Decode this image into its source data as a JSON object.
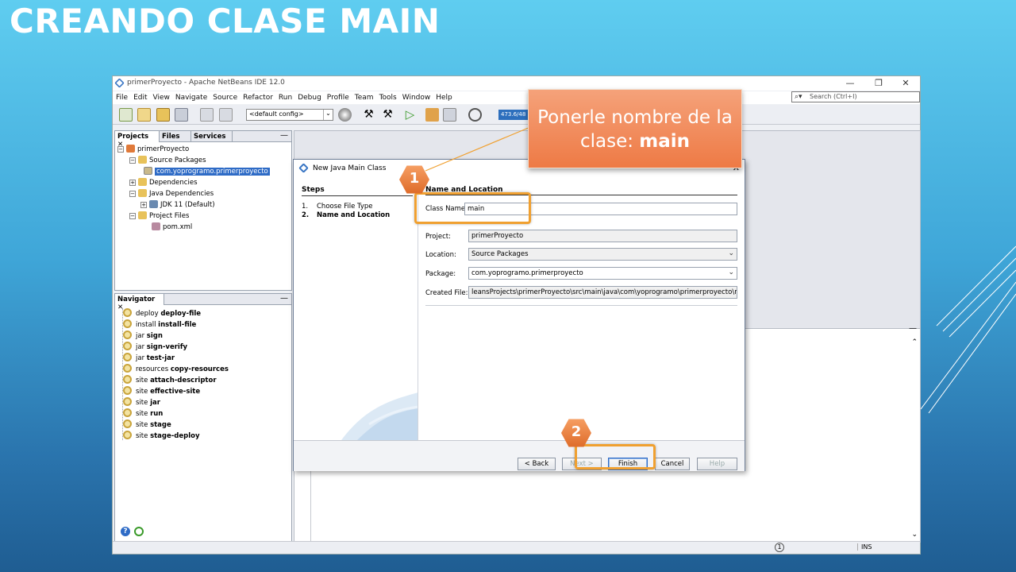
{
  "slide_title": "CREANDO CLASE MAIN",
  "window": {
    "title": "primerProyecto - Apache NetBeans IDE 12.0",
    "minimize": "—",
    "restore": "❐",
    "close": "✕"
  },
  "menu": [
    "File",
    "Edit",
    "View",
    "Navigate",
    "Source",
    "Refactor",
    "Run",
    "Debug",
    "Profile",
    "Team",
    "Tools",
    "Window",
    "Help"
  ],
  "search": {
    "placeholder": "Search (Ctrl+I)"
  },
  "toolbar": {
    "config": "<default config>",
    "memory": "473.6/48"
  },
  "projects_panel": {
    "tabs": [
      "Projects",
      "Files",
      "Services"
    ],
    "tree": [
      {
        "label": "primerProyecto"
      },
      {
        "label": "Source Packages"
      },
      {
        "label": "com.yoprogramo.primerproyecto"
      },
      {
        "label": "Dependencies"
      },
      {
        "label": "Java Dependencies"
      },
      {
        "label": "JDK 11 (Default)"
      },
      {
        "label": "Project Files"
      },
      {
        "label": "pom.xml"
      }
    ]
  },
  "navigator": {
    "tab": "Navigator",
    "items": [
      {
        "prefix": "deploy",
        "name": "deploy-file"
      },
      {
        "prefix": "install",
        "name": "install-file"
      },
      {
        "prefix": "jar",
        "name": "sign"
      },
      {
        "prefix": "jar",
        "name": "sign-verify"
      },
      {
        "prefix": "jar",
        "name": "test-jar"
      },
      {
        "prefix": "resources",
        "name": "copy-resources"
      },
      {
        "prefix": "site",
        "name": "attach-descriptor"
      },
      {
        "prefix": "site",
        "name": "effective-site"
      },
      {
        "prefix": "site",
        "name": "jar"
      },
      {
        "prefix": "site",
        "name": "run"
      },
      {
        "prefix": "site",
        "name": "stage"
      },
      {
        "prefix": "site",
        "name": "stage-deploy"
      }
    ]
  },
  "status": {
    "insert_mode": "INS"
  },
  "dialog": {
    "title": "New Java Main Class",
    "steps_heading": "Steps",
    "steps": [
      {
        "num": "1.",
        "label": "Choose File Type"
      },
      {
        "num": "2.",
        "label": "Name and Location"
      }
    ],
    "section_heading": "Name and Location",
    "fields": {
      "class_name": {
        "label": "Class Name:",
        "value": "main"
      },
      "project": {
        "label": "Project:",
        "value": "primerProyecto"
      },
      "location": {
        "label": "Location:",
        "value": "Source Packages"
      },
      "package": {
        "label": "Package:",
        "value": "com.yoprogramo.primerproyecto"
      },
      "created_file": {
        "label": "Created File:",
        "value": "leansProjects\\primerProyecto\\src\\main\\java\\com\\yoprogramo\\primerproyecto\\main.java"
      }
    },
    "buttons": {
      "back": "< Back",
      "next": "Next >",
      "finish": "Finish",
      "cancel": "Cancel",
      "help": "Help"
    }
  },
  "callout": {
    "text": "Ponerle nombre de la clase:",
    "emphasis": "main"
  },
  "badges": {
    "one": "1",
    "two": "2"
  },
  "colors": {
    "accent": "#ee7a45",
    "highlight": "#f0a030",
    "selection": "#2e6bc6"
  }
}
